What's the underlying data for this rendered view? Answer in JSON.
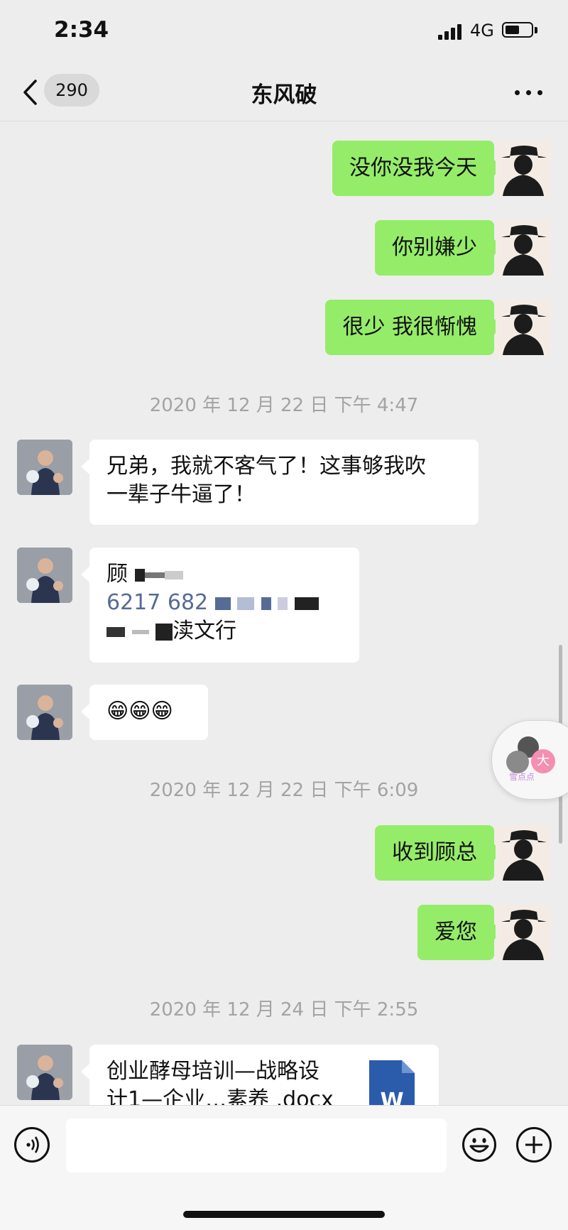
{
  "status_bar": {
    "time": "2:34",
    "network": "4G",
    "battery_level": 0.55
  },
  "nav": {
    "unread_count": "290",
    "title": "东风破"
  },
  "messages": {
    "m1": "没你没我今天",
    "m2": "你别嫌少",
    "m3": "很少 我很惭愧",
    "ts1": "2020 年 12 月 22 日 下午 4:47",
    "m4_line1": "兄弟，我就不客气了！这事够我吹",
    "m4_line2": "一辈子牛逼了！",
    "m5_line1": "顾",
    "m5_line2": "6217 682",
    "m5_line3": "渎文行",
    "m6": "😁😁😁",
    "ts2": "2020 年 12 月 22 日 下午 6:09",
    "m7": "收到顾总",
    "m8": "爱您",
    "ts3": "2020 年 12 月 24 日 下午 2:55",
    "file_name_line1": "创业酵母培训—战略设",
    "file_name_line2": "计1—企业…素养 .docx",
    "file_icon_letter": "W"
  },
  "floating": {
    "label": "大",
    "caption": "雪点点"
  },
  "colors": {
    "outgoing_bubble": "#95ec69",
    "link": "#576b95",
    "word_icon": "#2b5cab"
  },
  "icons": [
    "back-chevron-icon",
    "more-dots-icon",
    "voice-icon",
    "emoji-icon",
    "plus-icon",
    "word-file-icon"
  ]
}
